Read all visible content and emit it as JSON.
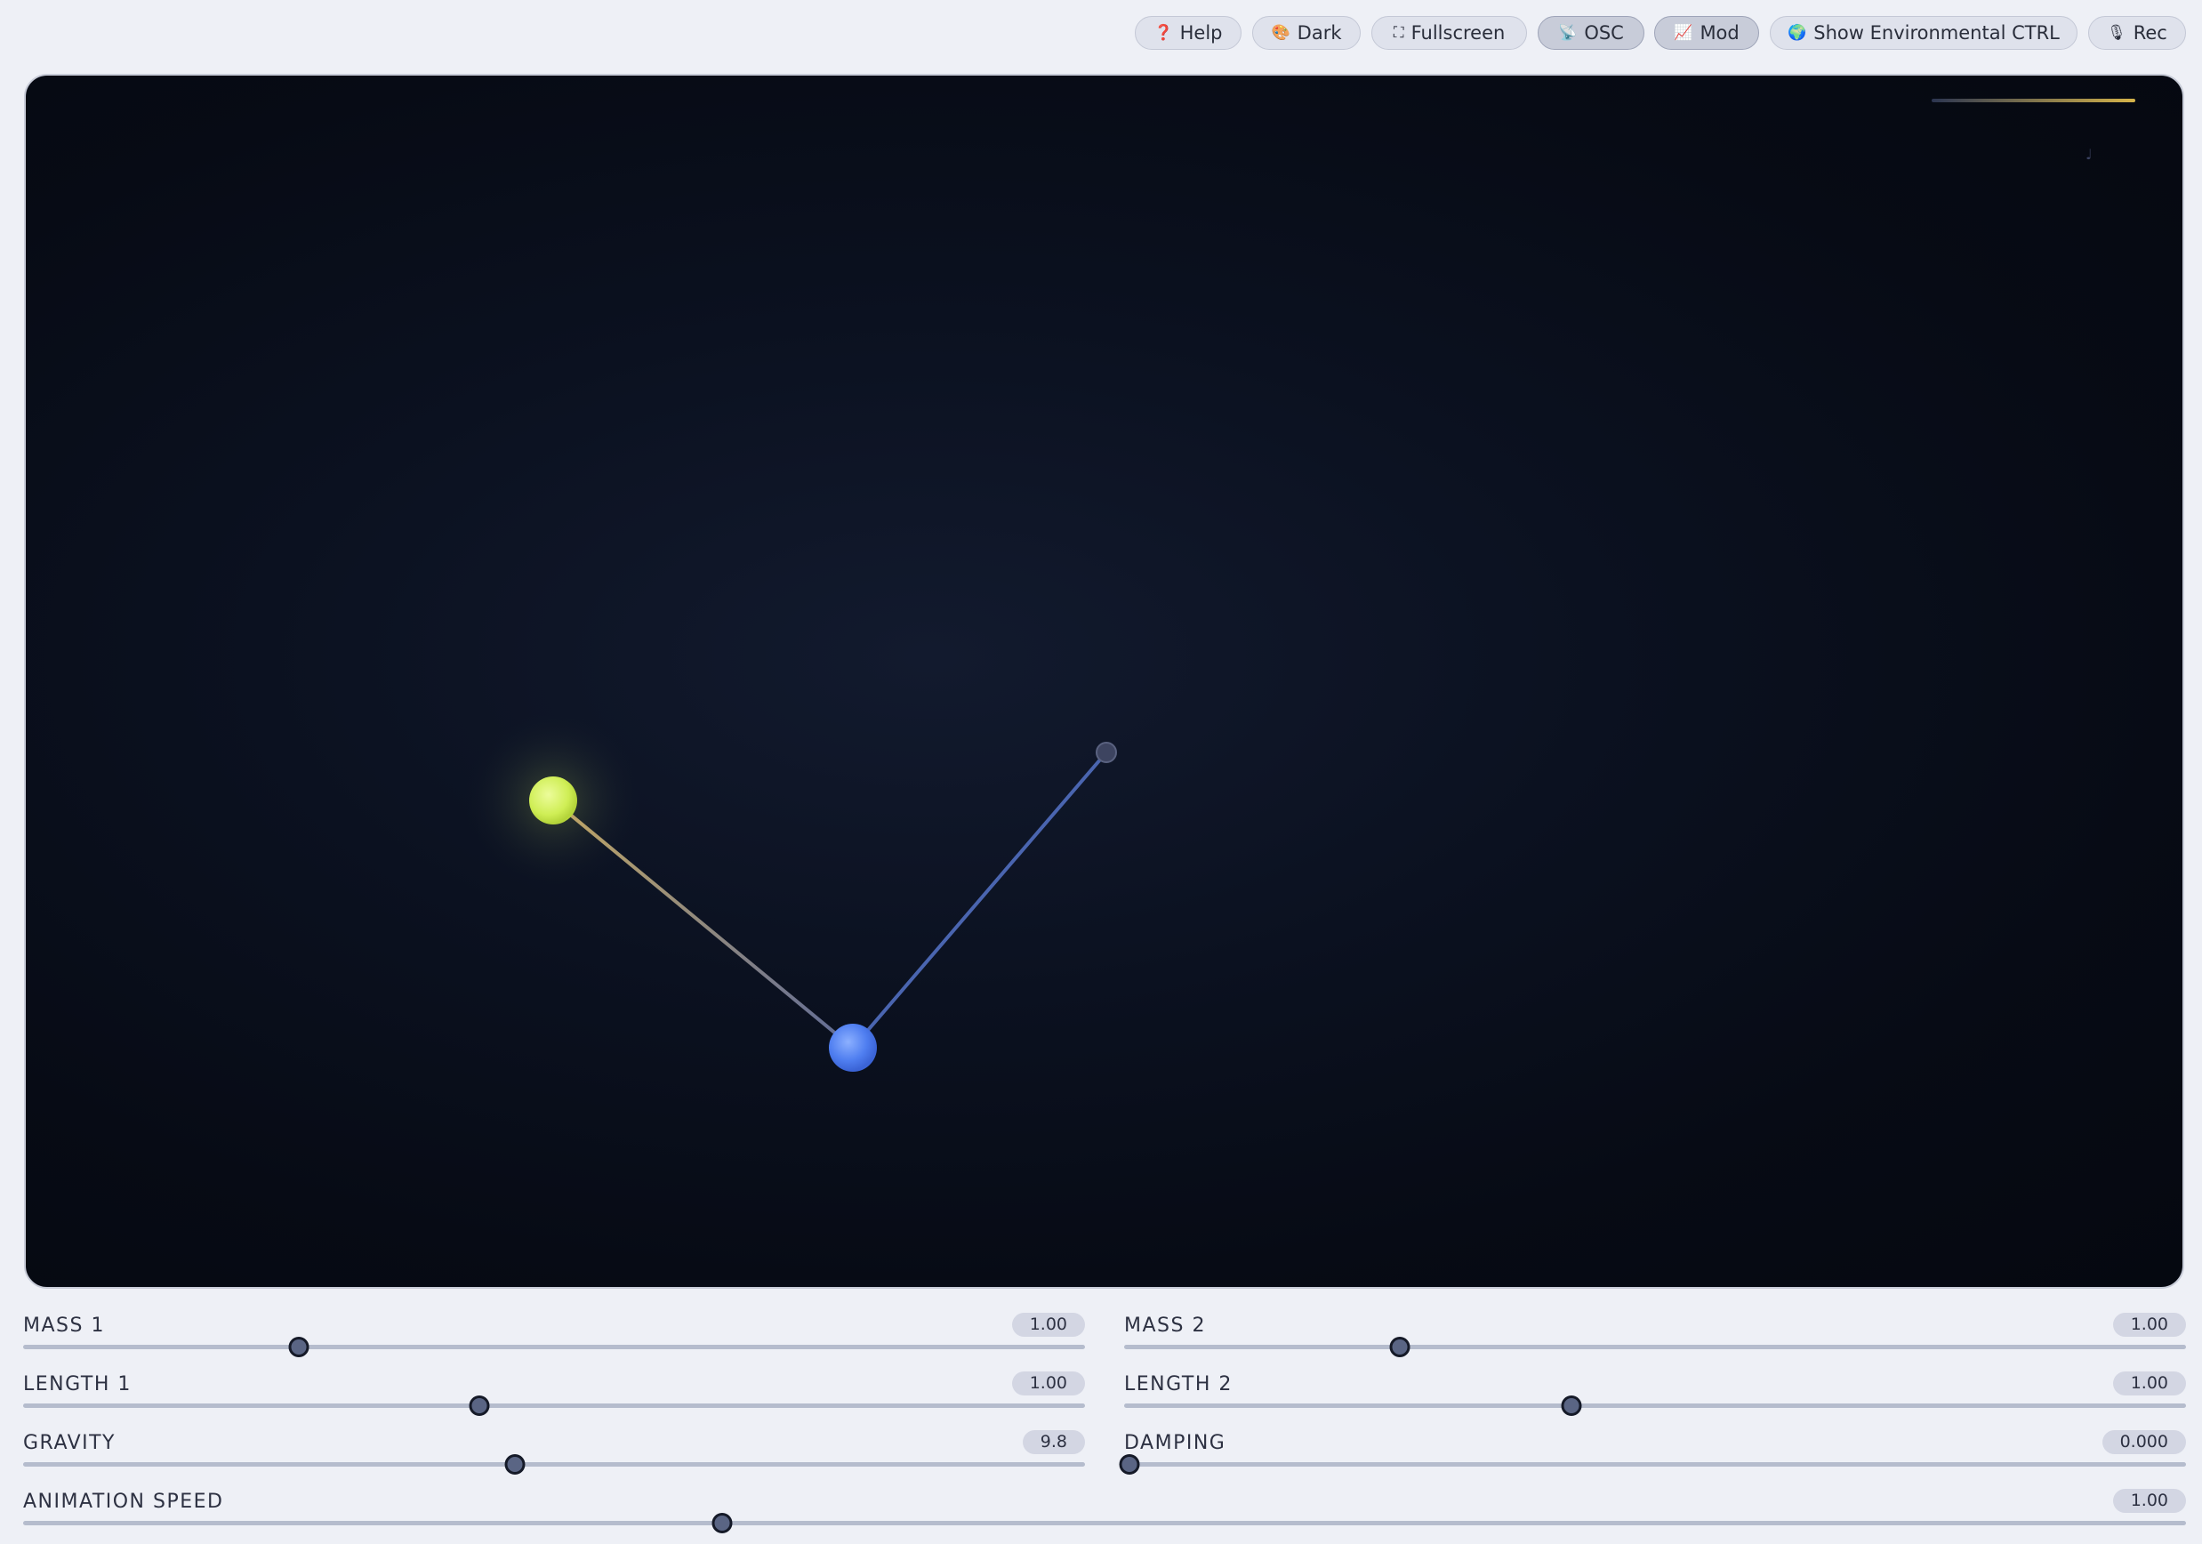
{
  "toolbar": {
    "buttons": [
      {
        "label": "Help",
        "icon": "help-icon",
        "glyph": "❓",
        "active": false
      },
      {
        "label": "Dark",
        "icon": "palette-icon",
        "glyph": "🎨",
        "active": false
      },
      {
        "label": "Fullscreen",
        "icon": "fullscreen-icon",
        "glyph": "⛶",
        "active": false
      },
      {
        "label": "OSC",
        "icon": "satellite-icon",
        "glyph": "📡",
        "active": true
      },
      {
        "label": "Mod",
        "icon": "chart-icon",
        "glyph": "📈",
        "active": true
      },
      {
        "label": "Show Environmental CTRL",
        "icon": "globe-icon",
        "glyph": "🌍",
        "active": false
      },
      {
        "label": "Rec",
        "icon": "microphone-icon",
        "glyph": "🎙",
        "active": false
      }
    ]
  },
  "simulation": {
    "bob1_color": "#d4f25c",
    "bob2_color": "#4f7ef0",
    "rod1_color": "#9a8a5e",
    "rod2_color": "#4a65b0",
    "meter_color": "#d6b44a",
    "meter_glyph": "♩"
  },
  "controls": {
    "mass1": {
      "label": "MASS 1",
      "value": "1.00",
      "fraction": 0.26
    },
    "mass2": {
      "label": "MASS 2",
      "value": "1.00",
      "fraction": 0.26
    },
    "length1": {
      "label": "LENGTH 1",
      "value": "1.00",
      "fraction": 0.43
    },
    "length2": {
      "label": "LENGTH 2",
      "value": "1.00",
      "fraction": 0.421
    },
    "gravity": {
      "label": "GRAVITY",
      "value": "9.8",
      "fraction": 0.463
    },
    "damping": {
      "label": "DAMPING",
      "value": "0.000",
      "fraction": 0.005
    },
    "speed": {
      "label": "ANIMATION SPEED",
      "value": "1.00",
      "fraction": 0.323
    }
  }
}
